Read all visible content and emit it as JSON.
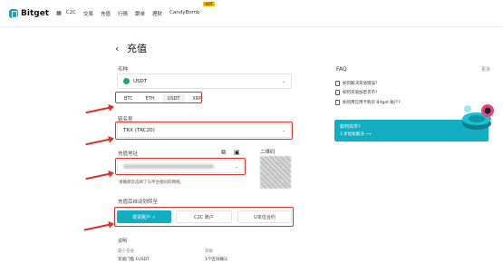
{
  "header": {
    "brand": "Bitget",
    "nav": [
      "C2C",
      "交易",
      "充值",
      "行情",
      "跟单",
      "理财",
      "CandyBomb"
    ],
    "hot_badge": "HOT"
  },
  "page": {
    "back": "‹",
    "title": "充值"
  },
  "coin": {
    "label": "币种",
    "value": "USDT",
    "chips": [
      "BTC",
      "ETH",
      "USDT",
      "XRP"
    ],
    "active_chip": "USDT"
  },
  "chain": {
    "label": "链名称",
    "value": "TRX (TRC20)"
  },
  "address": {
    "label": "充值地址",
    "note": "请确保您选择了与平台相同的网络。",
    "qr_label": "二维码"
  },
  "deposit_to": {
    "label": "充值后自动划转至",
    "options": [
      "现货账户 ✓",
      "C2C 账户",
      "U本位合约"
    ]
  },
  "info": {
    "label": "说明",
    "min_label": "最小充值",
    "arrival_label": "到账",
    "min_value": "充值门槛 1USDT",
    "arrival_value": "1个区块确认"
  },
  "faq": {
    "title": "FAQ",
    "more": "更多",
    "items": [
      "如何解决充值错误?",
      "如何充值加密货币?",
      "如何用信用卡购买 Bitget 账户?"
    ],
    "promo_line1": "如何充币?",
    "promo_line2": "3 步轻松解决 ⟶"
  },
  "colors": {
    "accent": "#12adc0",
    "annotation": "#d9332b"
  }
}
